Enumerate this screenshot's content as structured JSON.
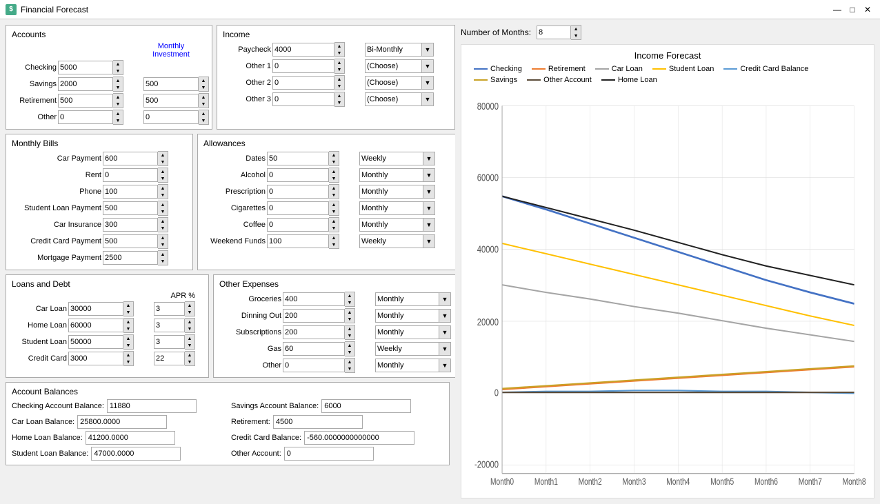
{
  "app": {
    "title": "Financial Forecast",
    "icon": "$"
  },
  "titlebar": {
    "minimize": "—",
    "maximize": "□",
    "close": "✕"
  },
  "accounts": {
    "title": "Accounts",
    "monthly_investment_label": "Monthly\nInvestment",
    "rows": [
      {
        "label": "Checking",
        "value": "5000",
        "investment": ""
      },
      {
        "label": "Savings",
        "value": "2000",
        "investment": "500"
      },
      {
        "label": "Retirement",
        "value": "500",
        "investment": "500"
      },
      {
        "label": "Other",
        "value": "0",
        "investment": "0"
      }
    ]
  },
  "income": {
    "title": "Income",
    "rows": [
      {
        "label": "Paycheck",
        "value": "4000",
        "freq": "Bi-Monthly"
      },
      {
        "label": "Other 1",
        "value": "0",
        "freq": "(Choose)"
      },
      {
        "label": "Other 2",
        "value": "0",
        "freq": "(Choose)"
      },
      {
        "label": "Other 3",
        "value": "0",
        "freq": "(Choose)"
      }
    ]
  },
  "monthly_bills": {
    "title": "Monthly Bills",
    "rows": [
      {
        "label": "Car Payment",
        "value": "600"
      },
      {
        "label": "Rent",
        "value": "0"
      },
      {
        "label": "Phone",
        "value": "100"
      },
      {
        "label": "Student Loan Payment",
        "value": "500"
      },
      {
        "label": "Car Insurance",
        "value": "300"
      },
      {
        "label": "Credit Card Payment",
        "value": "500"
      },
      {
        "label": "Mortgage Payment",
        "value": "2500"
      }
    ]
  },
  "allowances": {
    "title": "Allowances",
    "rows": [
      {
        "label": "Dates",
        "value": "50",
        "freq": "Weekly"
      },
      {
        "label": "Alcohol",
        "value": "0",
        "freq": "Monthly"
      },
      {
        "label": "Prescription",
        "value": "0",
        "freq": "Monthly"
      },
      {
        "label": "Cigarettes",
        "value": "0",
        "freq": "Monthly"
      },
      {
        "label": "Coffee",
        "value": "0",
        "freq": "Monthly"
      },
      {
        "label": "Weekend Funds",
        "value": "100",
        "freq": "Weekly"
      }
    ]
  },
  "loans": {
    "title": "Loans and Debt",
    "apr_label": "APR %",
    "rows": [
      {
        "label": "Car Loan",
        "value": "30000",
        "apr": "3"
      },
      {
        "label": "Home Loan",
        "value": "60000",
        "apr": "3"
      },
      {
        "label": "Student Loan",
        "value": "50000",
        "apr": "3"
      },
      {
        "label": "Credit Card",
        "value": "3000",
        "apr": "22"
      }
    ]
  },
  "other_expenses": {
    "title": "Other Expenses",
    "rows": [
      {
        "label": "Groceries",
        "value": "400",
        "freq": "Monthly"
      },
      {
        "label": "Dinning Out",
        "value": "200",
        "freq": "Monthly"
      },
      {
        "label": "Subscriptions",
        "value": "200",
        "freq": "Monthly"
      },
      {
        "label": "Gas",
        "value": "60",
        "freq": "Weekly"
      },
      {
        "label": "Other",
        "value": "0",
        "freq": "Monthly"
      }
    ]
  },
  "account_balances": {
    "title": "Account Balances",
    "left": [
      {
        "label": "Checking Account Balance:",
        "value": "11880"
      },
      {
        "label": "Car Loan Balance:",
        "value": "25800.0000"
      },
      {
        "label": "Home Loan Balance:",
        "value": "41200.0000"
      },
      {
        "label": "Student Loan Balance:",
        "value": "47000.0000"
      }
    ],
    "right": [
      {
        "label": "Savings Account Balance:",
        "value": "6000"
      },
      {
        "label": "Retirement:",
        "value": "4500"
      },
      {
        "label": "Credit Card Balance:",
        "value": "-560.0000000000000"
      },
      {
        "label": "Other Account:",
        "value": "0"
      }
    ]
  },
  "chart": {
    "title": "Income Forecast",
    "num_months_label": "Number of Months:",
    "num_months_value": "8",
    "x_labels": [
      "Month0",
      "Month1",
      "Month2",
      "Month3",
      "Month4",
      "Month5",
      "Month6",
      "Month7",
      "Month8"
    ],
    "y_labels": [
      "-20000",
      "0",
      "20000",
      "40000",
      "60000",
      "80000"
    ],
    "legend": [
      {
        "label": "Checking",
        "color": "#4472C4"
      },
      {
        "label": "Retirement",
        "color": "#ED7D31"
      },
      {
        "label": "Car Loan",
        "color": "#A5A5A5"
      },
      {
        "label": "Student Loan",
        "color": "#FFC000"
      },
      {
        "label": "Credit Card Balance",
        "color": "#5B9BD5"
      },
      {
        "label": "Savings",
        "color": "#C9A227"
      },
      {
        "label": "Other Account",
        "color": "#5B4C3A"
      },
      {
        "label": "Home Loan",
        "color": "#222222"
      }
    ]
  }
}
